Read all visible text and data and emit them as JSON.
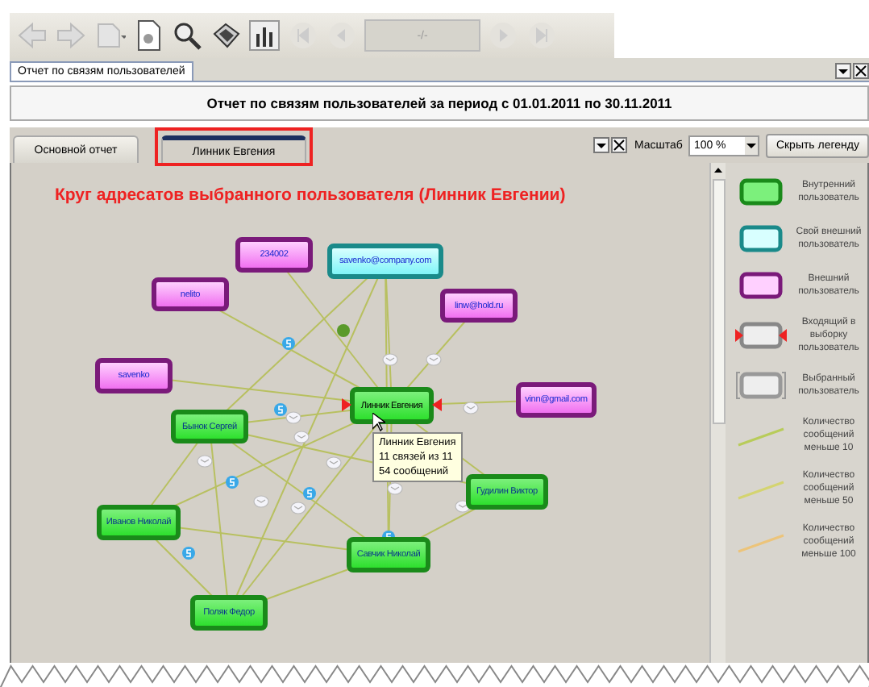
{
  "toolbar": {
    "page_field": "-/-"
  },
  "document_tab": {
    "label": "Отчет по связям пользователей",
    "selected": true
  },
  "report_title": "Отчет по связям пользователей за период с 01.01.2011 по 30.11.2011",
  "tabs": [
    {
      "label": "Основной отчет",
      "selected": false
    },
    {
      "label": "Линник Евгения",
      "selected": true
    }
  ],
  "scale": {
    "label": "Масштаб",
    "value": "100 %"
  },
  "hide_legend_button": "Скрыть легенду",
  "graph": {
    "title": "Круг адресатов выбранного пользователя (Линник Евгении)",
    "nodes": [
      {
        "label": "234002",
        "kind": "external",
        "selected": false
      },
      {
        "label": "savenko@company.com",
        "kind": "own_external",
        "selected": false
      },
      {
        "label": "nelito",
        "kind": "external",
        "selected": false
      },
      {
        "label": "linw@hold.ru",
        "kind": "external",
        "selected": false
      },
      {
        "label": "savenko",
        "kind": "external",
        "selected": false
      },
      {
        "label": "Линник Евгения",
        "kind": "internal",
        "selected": true
      },
      {
        "label": "vinn@gmail.com",
        "kind": "external",
        "selected": false
      },
      {
        "label": "Бынок Сергей",
        "kind": "internal",
        "selected": false
      },
      {
        "label": "Гудилин Виктор",
        "kind": "internal",
        "selected": false
      },
      {
        "label": "Иванов Николай",
        "kind": "internal",
        "selected": false
      },
      {
        "label": "Савчик Николай",
        "kind": "internal",
        "selected": false
      },
      {
        "label": "Поляк Федор",
        "kind": "internal",
        "selected": false
      }
    ],
    "tooltip": [
      "Линник Евгения",
      "11 связей из 11",
      "54 сообщений"
    ]
  },
  "legend": [
    {
      "kind": "internal",
      "label": "Внутренний пользователь"
    },
    {
      "kind": "own_external",
      "label": "Свой внешний пользователь"
    },
    {
      "kind": "external",
      "label": "Внешний пользователь"
    },
    {
      "kind": "incoming",
      "label": "Входящий в выборку пользователь"
    },
    {
      "kind": "selected",
      "label": "Выбранный пользователь"
    },
    {
      "kind": "line",
      "color": "#b8cc5a",
      "label": "Количество сообщений меньше 10"
    },
    {
      "kind": "line",
      "color": "#d4d470",
      "label": "Количество сообщений меньше 50"
    },
    {
      "kind": "line",
      "color": "#ecc47a",
      "label": "Количество сообщений меньше 100"
    }
  ]
}
